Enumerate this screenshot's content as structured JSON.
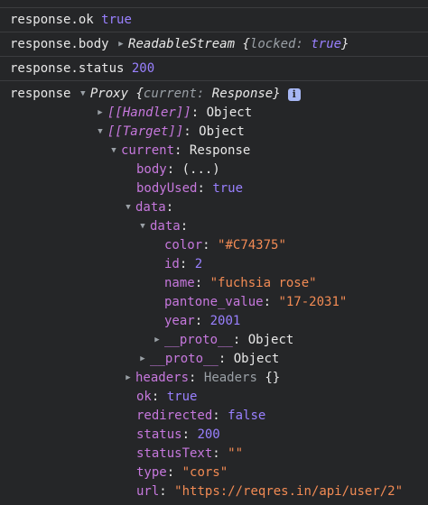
{
  "messages": {
    "ok": {
      "label": "response.ok",
      "value": "true"
    },
    "body": {
      "label": "response.body",
      "type_name": "ReadableStream",
      "open_brace": "{",
      "prop": "locked",
      "colon": ":",
      "value": "true",
      "close_brace": "}"
    },
    "status": {
      "label": "response.status",
      "value": "200"
    }
  },
  "response_object": {
    "label": "response",
    "preview": {
      "type_name": "Proxy",
      "open_brace": "{",
      "prop": "current",
      "colon": ":",
      "value": "Response",
      "close_brace": "}"
    },
    "info_icon": "i",
    "handler": {
      "key": "[[Handler]]",
      "colon": ":",
      "value": "Object"
    },
    "target": {
      "key": "[[Target]]",
      "colon": ":",
      "value": "Object"
    },
    "current": {
      "key": "current",
      "colon": ":",
      "value": "Response"
    },
    "body": {
      "key": "body",
      "colon": ":",
      "value": "(...)"
    },
    "bodyUsed": {
      "key": "bodyUsed",
      "colon": ":",
      "value": "true"
    },
    "data_outer": {
      "key": "data",
      "colon": ":"
    },
    "data_inner": {
      "key": "data",
      "colon": ":"
    },
    "color": {
      "key": "color",
      "colon": ":",
      "value": "\"#C74375\""
    },
    "id": {
      "key": "id",
      "colon": ":",
      "value": "2"
    },
    "name": {
      "key": "name",
      "colon": ":",
      "value": "\"fuchsia rose\""
    },
    "pantone_value": {
      "key": "pantone_value",
      "colon": ":",
      "value": "\"17-2031\""
    },
    "year": {
      "key": "year",
      "colon": ":",
      "value": "2001"
    },
    "proto_inner": {
      "key": "__proto__",
      "colon": ":",
      "value": "Object"
    },
    "proto_outer": {
      "key": "__proto__",
      "colon": ":",
      "value": "Object"
    },
    "headers": {
      "key": "headers",
      "colon": ":",
      "type_name": "Headers",
      "value": "{}"
    },
    "ok": {
      "key": "ok",
      "colon": ":",
      "value": "true"
    },
    "redirected": {
      "key": "redirected",
      "colon": ":",
      "value": "false"
    },
    "status": {
      "key": "status",
      "colon": ":",
      "value": "200"
    },
    "statusText": {
      "key": "statusText",
      "colon": ":",
      "value": "\"\""
    },
    "type": {
      "key": "type",
      "colon": ":",
      "value": "\"cors\""
    },
    "url": {
      "key": "url",
      "colon": ":",
      "value": "\"https://reqres.in/api/user/2\""
    }
  },
  "colors": {
    "background": "#252628",
    "separator": "#3b3c3f",
    "keyword": "#9980ff",
    "string": "#f28b54",
    "property_key": "#c678dd",
    "dimmed": "#9aa0a6",
    "text": "#e6e6e6",
    "info_badge": "#a7b7f4"
  },
  "icons": {
    "expanded": "triangle-down-icon",
    "collapsed": "triangle-right-icon",
    "info": "info-icon"
  }
}
